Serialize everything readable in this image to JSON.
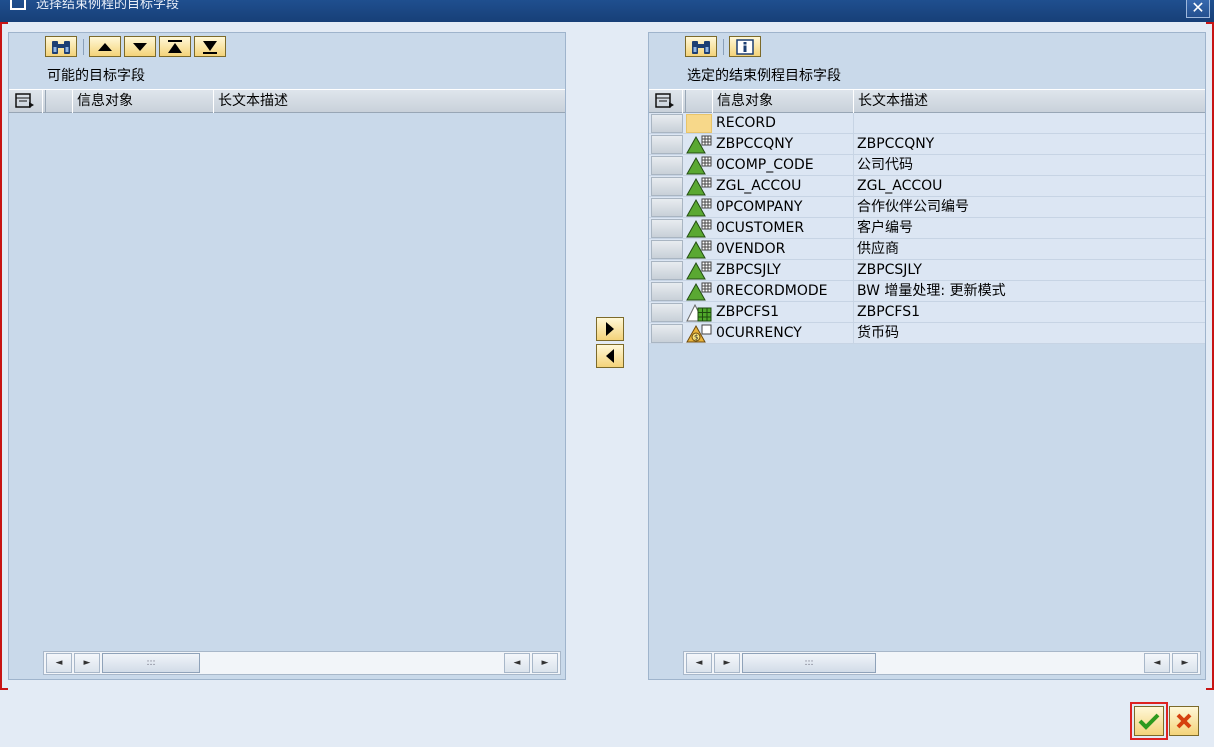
{
  "window": {
    "title": "选择结束例程的目标字段"
  },
  "left_panel": {
    "title": "可能的目标字段",
    "columns": [
      "信息对象",
      "长文本描述"
    ]
  },
  "right_panel": {
    "title": "选定的结束例程目标字段",
    "columns": [
      "信息对象",
      "长文本描述"
    ],
    "rows": [
      {
        "icon": "record-icon",
        "name": "RECORD",
        "desc": ""
      },
      {
        "icon": "characteristic-icon",
        "name": "ZBPCCQNY",
        "desc": "ZBPCCQNY"
      },
      {
        "icon": "characteristic-icon",
        "name": "0COMP_CODE",
        "desc": "公司代码"
      },
      {
        "icon": "characteristic-icon",
        "name": "ZGL_ACCOU",
        "desc": "ZGL_ACCOU"
      },
      {
        "icon": "characteristic-icon",
        "name": "0PCOMPANY",
        "desc": "合作伙伴公司编号"
      },
      {
        "icon": "characteristic-icon",
        "name": "0CUSTOMER",
        "desc": "客户编号"
      },
      {
        "icon": "characteristic-icon",
        "name": "0VENDOR",
        "desc": "供应商"
      },
      {
        "icon": "characteristic-icon",
        "name": "ZBPCSJLY",
        "desc": "ZBPCSJLY"
      },
      {
        "icon": "characteristic-icon",
        "name": "0RECORDMODE",
        "desc": "BW 增量处理: 更新模式"
      },
      {
        "icon": "key-figure-icon",
        "name": "ZBPCFS1",
        "desc": "ZBPCFS1"
      },
      {
        "icon": "unit-icon",
        "name": "0CURRENCY",
        "desc": "货币码"
      }
    ]
  },
  "colors": {
    "accent": "#f4d37a",
    "titlebar": "#1f4f8f",
    "frame_border": "#c81414"
  }
}
